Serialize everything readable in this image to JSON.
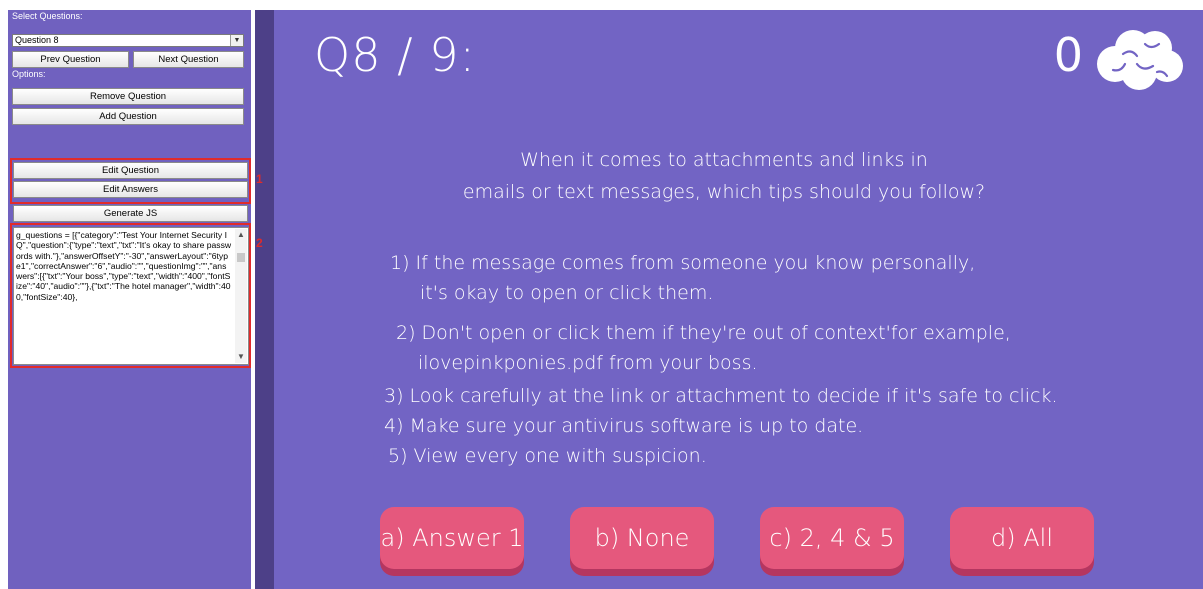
{
  "editor": {
    "select_label": "Select Questions:",
    "selected_question": "Question 8",
    "prev_button": "Prev Question",
    "next_button": "Next Question",
    "options_label": "Options:",
    "remove_button": "Remove Question",
    "add_button": "Add Question",
    "edit_question_button": "Edit Question",
    "edit_answers_button": "Edit Answers",
    "generate_button": "Generate JS",
    "code_text": "g_questions = [{\"category\":\"Test Your Internet Security IQ\",\"question\":{\"type\":\"text\",\"txt\":\"It's okay to share passwords with.\"},\"answerOffsetY\":\"-30\",\"answerLayout\":\"6type1\",\"correctAnswer\":\"6\",\"audio\":\"\",\"questionImg\":\"\",\"answers\":[{\"txt\":\"Your boss\",\"type\":\"text\",\"width\":\"400\",\"fontSize\":\"40\",\"audio\":\"\"},{\"txt\":\"The hotel manager\",\"width\":400,\"fontSize\":40},",
    "annotation_1": "1",
    "annotation_2": "2",
    "highlight_color": "#e02b2b"
  },
  "quiz": {
    "question_counter": "Q8 / 9:",
    "score": "0",
    "score_icon": "brain-icon",
    "question_line1": "When it comes to attachments and links in",
    "question_line2": "emails or text messages, which tips should you follow?",
    "options": [
      "1) If the message comes from someone you know personally,",
      "it's okay to open or click them.",
      "2) Don't open or click them if they're out of context'for example,",
      "ilovepinkponies.pdf from your boss.",
      "3) Look carefully at the link or attachment to decide if it's safe to click.",
      "4) Make sure your antivirus software is up to date.",
      "5) View every one with suspicion."
    ],
    "answers": [
      "a) Answer 1",
      "b) None",
      "c) 2, 4 & 5",
      "d) All"
    ],
    "background_color": "#7264c4",
    "answer_color": "#e5587d"
  }
}
